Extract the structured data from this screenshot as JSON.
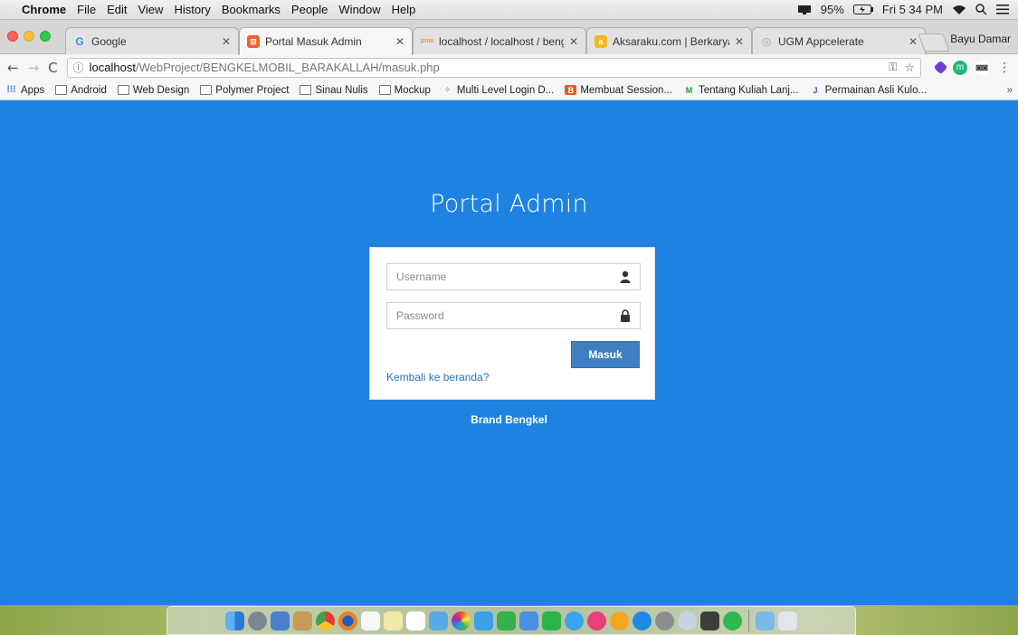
{
  "menubar": {
    "apple_glyph": "",
    "items": [
      "Chrome",
      "File",
      "Edit",
      "View",
      "History",
      "Bookmarks",
      "People",
      "Window",
      "Help"
    ],
    "battery": "95%",
    "clock": "Fri 5 34 PM"
  },
  "tabs": [
    {
      "title": "Google",
      "favicon": "G",
      "favicon_color": "#4285f4"
    },
    {
      "title": "Portal Masuk Admin",
      "favicon": "⊠",
      "favicon_color": "#e9642b"
    },
    {
      "title": "localhost / localhost / bengk",
      "favicon": "pma",
      "favicon_color": "#f0a020"
    },
    {
      "title": "Aksaraku.com | Berkarya Ad",
      "favicon": "a",
      "favicon_color": "#f2b820"
    },
    {
      "title": "UGM Appcelerate",
      "favicon": "◎",
      "favicon_color": "#9aa9c8"
    }
  ],
  "profile_name": "Bayu Damar",
  "address": {
    "host": "localhost",
    "path": "/WebProject/BENGKELMOBIL_BARAKALLAH/masuk.php"
  },
  "bookmarks": [
    {
      "label": "Apps",
      "icon": "apps-icon"
    },
    {
      "label": "Android",
      "icon": "folder-icon"
    },
    {
      "label": "Web Design",
      "icon": "folder-icon"
    },
    {
      "label": "Polymer Project",
      "icon": "folder-icon"
    },
    {
      "label": "Sinau Nulis",
      "icon": "folder-icon"
    },
    {
      "label": "Mockup",
      "icon": "folder-icon"
    },
    {
      "label": "Multi Level Login D...",
      "icon": "multilevel-icon"
    },
    {
      "label": "Membuat Session...",
      "icon": "blogger-icon"
    },
    {
      "label": "Tentang Kuliah Lanj...",
      "icon": "medium-icon"
    },
    {
      "label": "Permainan Asli Kulo...",
      "icon": "jv-icon"
    }
  ],
  "bookmarks_more": "»",
  "login": {
    "title": "Portal Admin",
    "username_placeholder": "Username",
    "password_placeholder": "Password",
    "submit_label": "Masuk",
    "back_link": "Kembali ke beranda?",
    "brand": "Brand Bengkel"
  },
  "colors": {
    "page_background": "#1e82e0",
    "button": "#3d7fc0",
    "link": "#2a6fc4"
  }
}
